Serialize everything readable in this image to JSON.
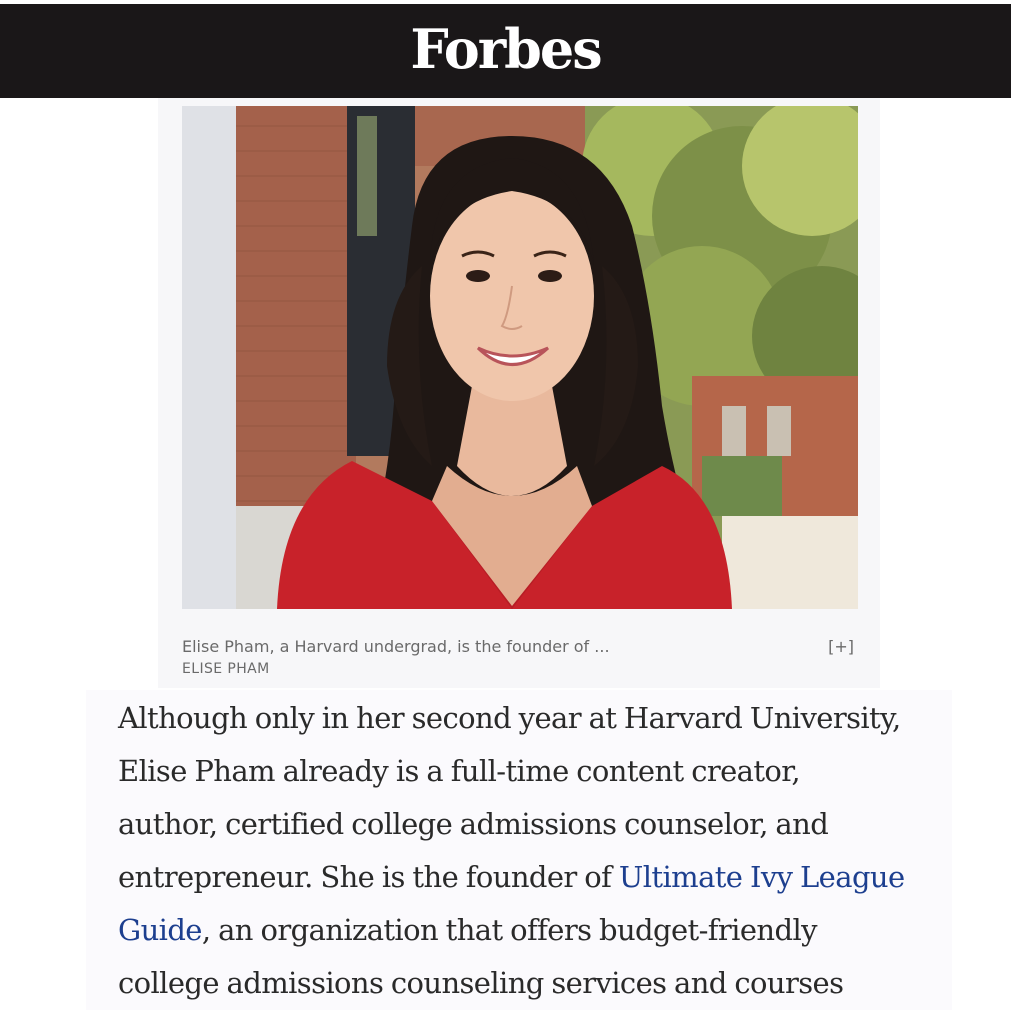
{
  "header": {
    "logo": "Forbes"
  },
  "photo": {
    "subject": "portrait-photo"
  },
  "caption": {
    "text": "Elise Pham, a Harvard undergrad, is the founder of ...",
    "expand_label": "[+]",
    "credit": "ELISE PHAM"
  },
  "article": {
    "line1": "Although only in her second year at Harvard University,",
    "line2": "Elise Pham already is a full-time content creator,",
    "line3": "author, certified college admissions counselor, and",
    "line4_before": "entrepreneur. She is the founder of ",
    "link_part1": "Ultimate Ivy League",
    "link_part2": "Guide",
    "line5_after": ", an organization that offers budget-friendly",
    "line6": "college admissions counseling services and courses"
  },
  "colors": {
    "header_bg": "#1a1718",
    "link": "#1d3f8f",
    "body_text": "#2a2a2a",
    "caption_text": "#6a6a6a"
  }
}
